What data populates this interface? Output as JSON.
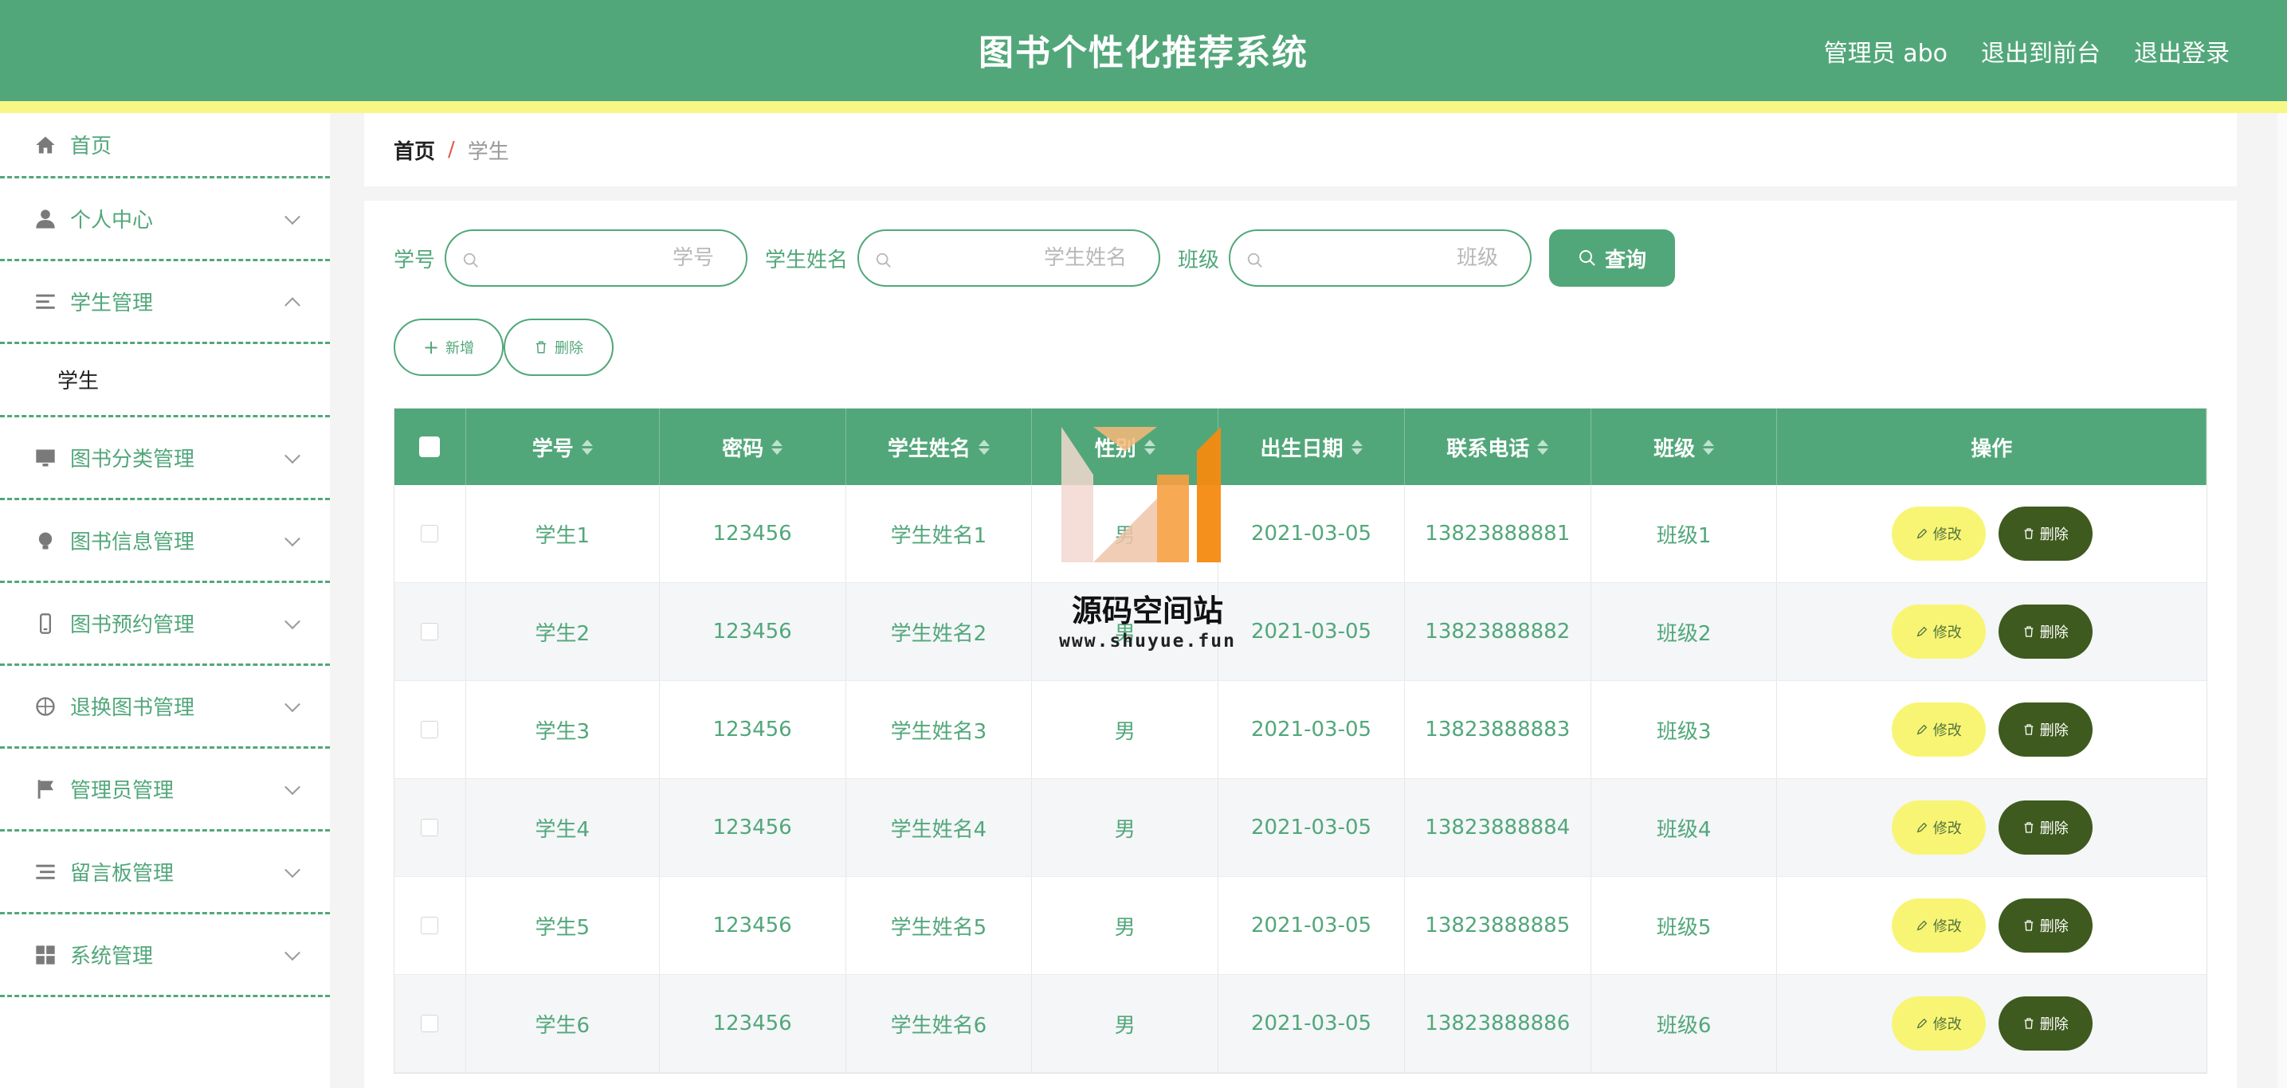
{
  "header": {
    "title": "图书个性化推荐系统",
    "user_label": "管理员 abo",
    "front_link": "退出到前台",
    "logout_link": "退出登录"
  },
  "sidebar": {
    "items": [
      {
        "label": "首页",
        "icon": "home-icon"
      },
      {
        "label": "个人中心",
        "icon": "user-icon"
      },
      {
        "label": "学生管理",
        "icon": "list-icon",
        "expanded": true,
        "children": [
          {
            "label": "学生"
          }
        ]
      },
      {
        "label": "图书分类管理",
        "icon": "monitor-icon"
      },
      {
        "label": "图书信息管理",
        "icon": "bulb-icon"
      },
      {
        "label": "图书预约管理",
        "icon": "phone-icon"
      },
      {
        "label": "退换图书管理",
        "icon": "compass-icon"
      },
      {
        "label": "管理员管理",
        "icon": "flag-icon"
      },
      {
        "label": "留言板管理",
        "icon": "lines-icon"
      },
      {
        "label": "系统管理",
        "icon": "grid-icon"
      }
    ]
  },
  "breadcrumb": {
    "home": "首页",
    "separator": "/",
    "current": "学生"
  },
  "search": {
    "student_no_label": "学号",
    "student_no_placeholder": "学号",
    "name_label": "学生姓名",
    "name_placeholder": "学生姓名",
    "class_label": "班级",
    "class_placeholder": "班级",
    "query_button": "查询"
  },
  "actions": {
    "add_button": "新增",
    "delete_button": "删除"
  },
  "table": {
    "columns": [
      "学号",
      "密码",
      "学生姓名",
      "性别",
      "出生日期",
      "联系电话",
      "班级",
      "操作"
    ],
    "edit_label": "修改",
    "delete_label": "删除",
    "rows": [
      [
        "学生1",
        "123456",
        "学生姓名1",
        "男",
        "2021-03-05",
        "13823888881",
        "班级1"
      ],
      [
        "学生2",
        "123456",
        "学生姓名2",
        "男",
        "2021-03-05",
        "13823888882",
        "班级2"
      ],
      [
        "学生3",
        "123456",
        "学生姓名3",
        "男",
        "2021-03-05",
        "13823888883",
        "班级3"
      ],
      [
        "学生4",
        "123456",
        "学生姓名4",
        "男",
        "2021-03-05",
        "13823888884",
        "班级4"
      ],
      [
        "学生5",
        "123456",
        "学生姓名5",
        "男",
        "2021-03-05",
        "13823888885",
        "班级5"
      ],
      [
        "学生6",
        "123456",
        "学生姓名6",
        "男",
        "2021-03-05",
        "13823888886",
        "班级6"
      ]
    ]
  },
  "watermark": {
    "text": "源码空间站",
    "url": "www.shuyue.fun"
  },
  "colors": {
    "primary": "#52a77a",
    "accent_stripe": "#f7f786",
    "edit_button": "#f8f574",
    "delete_button": "#3e5a1e"
  }
}
